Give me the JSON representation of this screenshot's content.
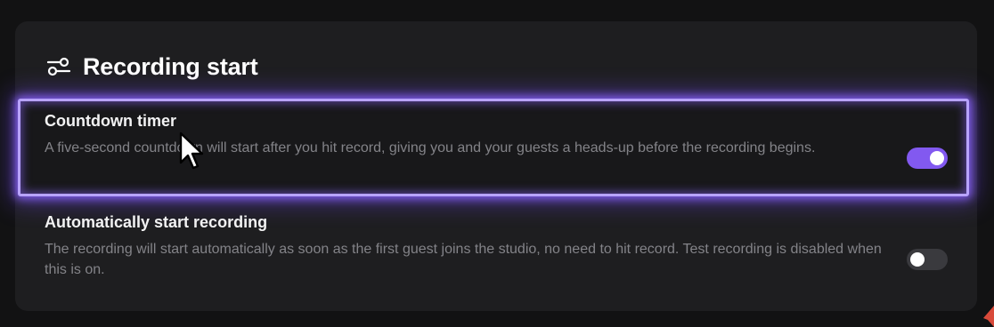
{
  "section": {
    "title": "Recording start",
    "icon": "sliders-icon"
  },
  "settings": [
    {
      "label": "Countdown timer",
      "description": "A five-second countdown will start after you hit record, giving you and your guests a heads-up before the recording begins.",
      "toggle_state": "on",
      "highlighted": true
    },
    {
      "label": "Automatically start recording",
      "description": "The recording will start automatically as soon as the first guest joins the studio, no need to hit record. Test recording is disabled when this is on.",
      "toggle_state": "off",
      "highlighted": false
    }
  ],
  "colors": {
    "accent": "#8259f0",
    "highlight_border": "#b8a3ff",
    "card_bg": "#1e1e20",
    "page_bg": "#121213"
  }
}
